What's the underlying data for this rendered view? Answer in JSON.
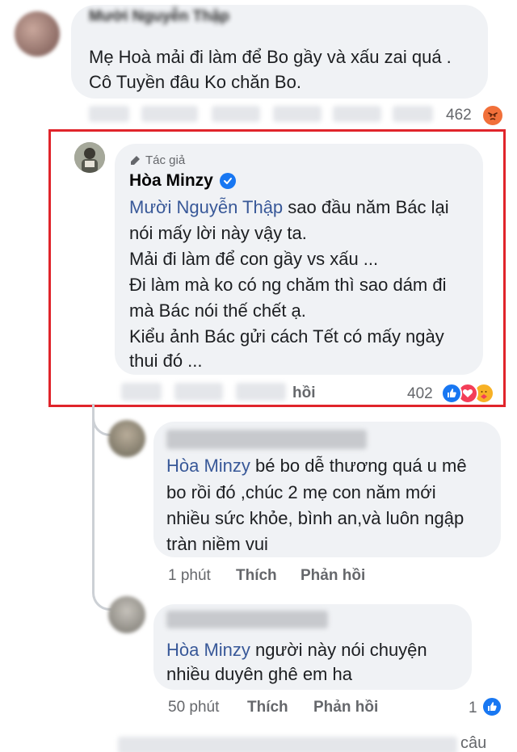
{
  "comment1": {
    "author": "Mười Nguyễn Thập",
    "text_line1": "Mẹ Hoà mải đi làm để Bo gầy và xấu zai quá .",
    "text_line2": "Cô Tuyền đâu Ko chăn Bo.",
    "reaction_count": "462",
    "reaction_icon": "angry-react-icon"
  },
  "reply_author": {
    "badge": "Tác giả",
    "name": "Hòa Minzy",
    "mention": "Mười Nguyễn Thập",
    "line1_rest": " sao đầu năm Bác lại",
    "line2": "nói mấy lời này vậy ta.",
    "line3": "Mải đi làm để con gầy vs xấu ...",
    "line4": "Đi làm mà ko có ng chăm thì sao dám đi",
    "line5": "mà Bác nói thế chết ạ.",
    "line6": "Kiểu ảnh Bác gửi cách Tết có mấy ngày",
    "line7": "thui đó ...",
    "reply_label": "hồi",
    "reaction_count": "402",
    "reaction_icons": [
      "like-icon",
      "love-icon",
      "care-icon"
    ],
    "colors": {
      "highlight": "#e0242b",
      "verified": "#1877f2"
    }
  },
  "comment3": {
    "mention": "Hòa Minzy",
    "line1_rest": " bé bo dễ thương quá u mê",
    "line2": "bo rồi đó ,chúc 2 mẹ con năm mới",
    "line3": "nhiều sức khỏe, bình an,và luôn ngập",
    "line4": "tràn niềm vui",
    "time": "1 phút",
    "like": "Thích",
    "reply": "Phản hồi"
  },
  "comment4": {
    "mention": "Hòa Minzy",
    "line1_rest": " người này nói chuyện",
    "line2": "nhiều duyên ghê em ha",
    "time": "50 phút",
    "like": "Thích",
    "reply": "Phản hồi",
    "reaction_count": "1",
    "reaction_icon": "like-icon"
  },
  "footer": {
    "partial_text": "câu"
  }
}
